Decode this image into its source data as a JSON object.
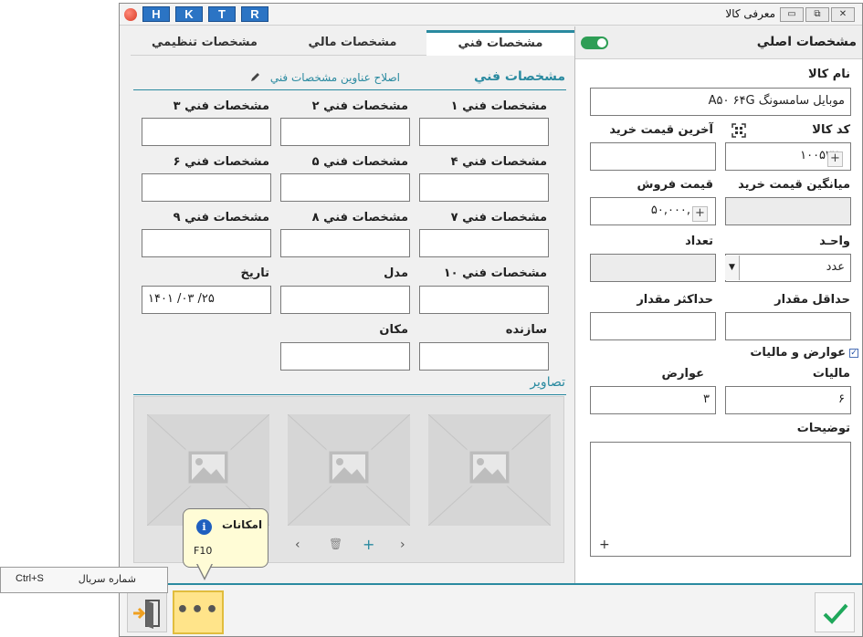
{
  "window": {
    "title": "معرفی کالا",
    "hotkeys": [
      "H",
      "K",
      "T",
      "R"
    ],
    "controls": {
      "minimize": "▭",
      "restore": "⧉",
      "close": "✕"
    }
  },
  "main": {
    "title": "مشخصات اصلي",
    "name_label": "نام کالا",
    "name_value": "موبايل سامسونگ A۵۰ ۶۴G",
    "code_label": "کد کالا",
    "code_value": "۱۰۰۵۲۲۰",
    "last_price_label": "آخرين قيمت خريد",
    "last_price_value": "",
    "avg_price_label": "ميانگين قيمت خريد",
    "avg_price_value": "",
    "sale_price_label": "قيمت فروش",
    "sale_price_value": "۵۰,۰۰۰,۰۰۰",
    "unit_label": "واحـد",
    "unit_value": "عدد",
    "count_label": "تعداد",
    "count_value": "",
    "min_label": "حداقل مقدار",
    "min_value": "",
    "max_label": "حداکثر مقدار",
    "max_value": "",
    "duties_checkbox_label": "عوارض و ماليات",
    "tax_label": "ماليات",
    "tax_value": "۶",
    "duties_label": "عوارض",
    "duties_value": "۳",
    "desc_label": "توضيحات",
    "desc_value": "",
    "plus": "+"
  },
  "tabs": [
    {
      "label": "مشخصات فني"
    },
    {
      "label": "مشخصات مالي"
    },
    {
      "label": "مشخصات تنظيمي"
    }
  ],
  "tech": {
    "section_title": "مشخصات فني",
    "edit_link": "اصلاح عناوين مشخصات فني",
    "fields": [
      "مشخصات فني ۱",
      "مشخصات فني ۲",
      "مشخصات فني ۳",
      "مشخصات فني ۴",
      "مشخصات فني ۵",
      "مشخصات فني ۶",
      "مشخصات فني ۷",
      "مشخصات فني ۸",
      "مشخصات فني ۹",
      "مشخصات فني ۱۰",
      "مدل",
      "تاريخ",
      "سازنده",
      "مکان"
    ],
    "date_value": "۱۴۰۱   /۰۳   /۲۵",
    "images_title": "تصاوير",
    "gallery": {
      "prev": "‹",
      "delete": "🗑",
      "add": "+",
      "next": "›"
    }
  },
  "tooltip": {
    "title": "امکانات",
    "shortcut": "F10"
  },
  "context_menu": {
    "item_label": "شماره سريال",
    "item_shortcut": "Ctrl+S"
  },
  "bottom": {
    "more_label": "•••"
  },
  "colors": {
    "accent": "#2a8aa0",
    "hotkey_blue": "#2b74c4",
    "toggle_green": "#2e9e55",
    "more_yellow": "#ffe48a",
    "ok_green": "#1fa85b"
  }
}
